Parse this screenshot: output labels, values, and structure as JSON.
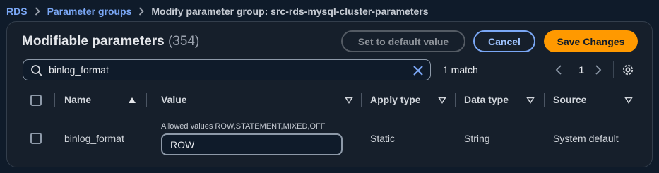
{
  "breadcrumb": {
    "items": [
      "RDS",
      "Parameter groups"
    ],
    "current": "Modify parameter group: src-rds-mysql-cluster-parameters"
  },
  "panel": {
    "title": "Modifiable parameters",
    "count": "(354)"
  },
  "buttons": {
    "set_default": "Set to default value",
    "cancel": "Cancel",
    "save": "Save Changes"
  },
  "search": {
    "value": "binlog_format",
    "match_text": "1 match"
  },
  "pagination": {
    "current_page": "1"
  },
  "table": {
    "columns": [
      "Name",
      "Value",
      "Apply type",
      "Data type",
      "Source"
    ],
    "rows": [
      {
        "name": "binlog_format",
        "allowed_values_label": "Allowed values ROW,STATEMENT,MIXED,OFF",
        "value": "ROW",
        "apply_type": "Static",
        "data_type": "String",
        "source": "System default"
      }
    ]
  },
  "colors": {
    "background": "#0f1b2a",
    "panel": "#161f2b",
    "primary_button": "#ff9900",
    "link": "#7aa7f5"
  }
}
